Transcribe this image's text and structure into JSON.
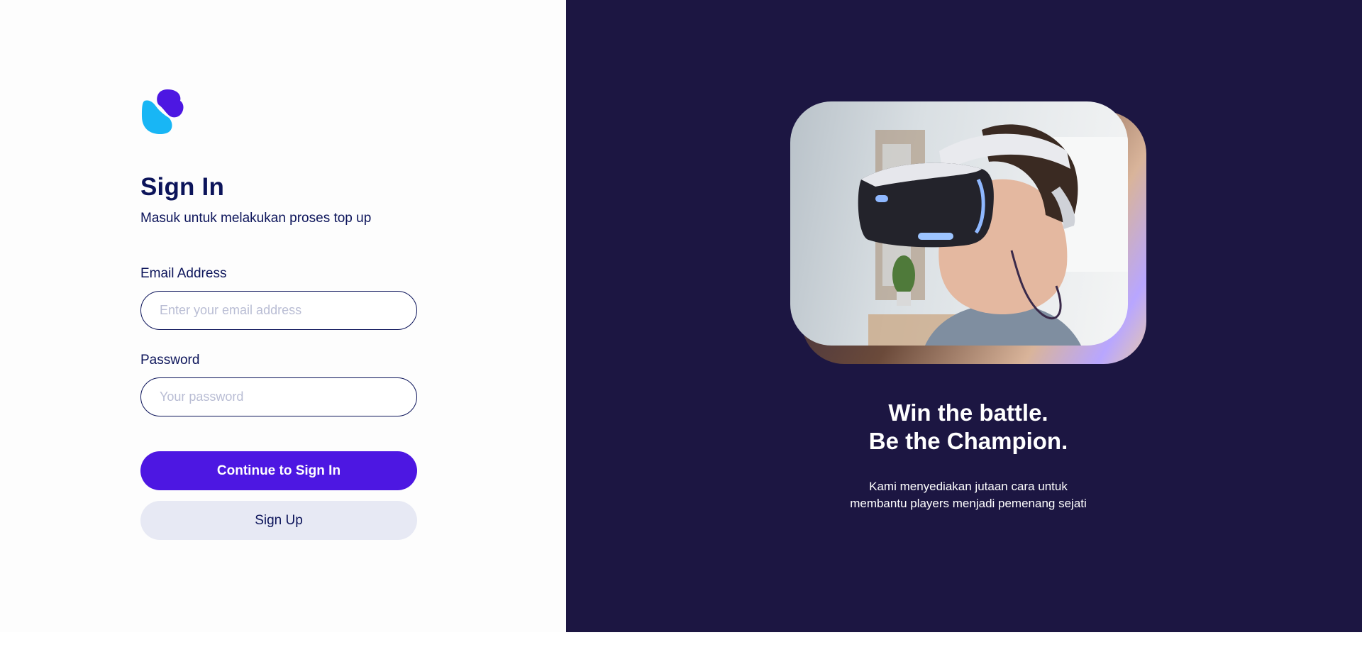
{
  "brand": {
    "logo_icon": "s-swirl-logo-icon",
    "colors": {
      "blue": "#18b6f5",
      "purple": "#4d17e2",
      "navy": "#0c145a"
    }
  },
  "signin": {
    "title": "Sign In",
    "subtitle": "Masuk untuk melakukan proses top up",
    "email": {
      "label": "Email Address",
      "placeholder": "Enter your email address",
      "value": ""
    },
    "password": {
      "label": "Password",
      "placeholder": "Your password",
      "value": ""
    },
    "primary_button": "Continue to Sign In",
    "secondary_button": "Sign Up"
  },
  "hero": {
    "image": "boy-wearing-vr-headset",
    "headline_line1": "Win the battle.",
    "headline_line2": "Be the Champion.",
    "description": "Kami menyediakan jutaan cara untuk membantu players menjadi pemenang sejati"
  },
  "theme": {
    "panel_bg": "#1c1642",
    "accent": "#4d17e2",
    "secondary_button_bg": "#e7e9f4"
  }
}
